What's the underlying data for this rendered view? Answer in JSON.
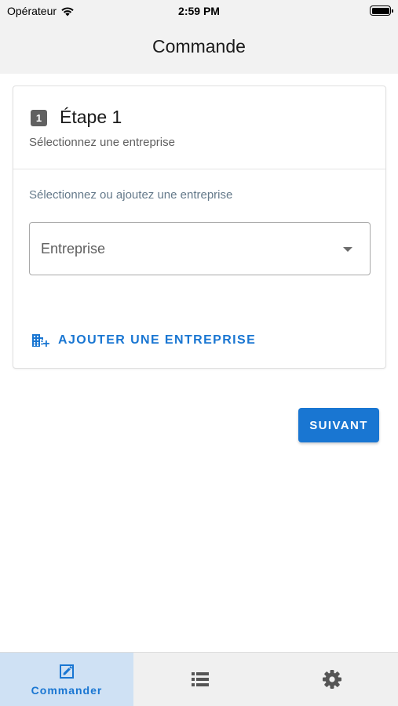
{
  "status_bar": {
    "carrier": "Opérateur",
    "time": "2:59 PM",
    "icons": [
      "wifi-icon",
      "battery-icon"
    ],
    "battery_level": 1.0
  },
  "nav": {
    "title": "Commande"
  },
  "step": {
    "number": "1",
    "title": "Étape 1",
    "subtitle": "Sélectionnez une entreprise"
  },
  "company_select": {
    "hint": "Sélectionnez ou ajoutez une entreprise",
    "value": "Entreprise",
    "icon": "chevron-down-icon"
  },
  "add_company": {
    "label": "AJOUTER UNE ENTREPRISE",
    "icon": "add-business-icon"
  },
  "next_button": {
    "label": "SUIVANT"
  },
  "tabs": [
    {
      "label": "Commander",
      "icon": "edit-square-icon",
      "active": true
    },
    {
      "label": "",
      "icon": "list-icon",
      "active": false
    },
    {
      "label": "",
      "icon": "gear-icon",
      "active": false
    }
  ],
  "colors": {
    "accent": "#1976d2",
    "active_tab_bg": "#cfe1f4",
    "bar_bg": "#f2f2f2",
    "icon_gray": "#616161"
  }
}
